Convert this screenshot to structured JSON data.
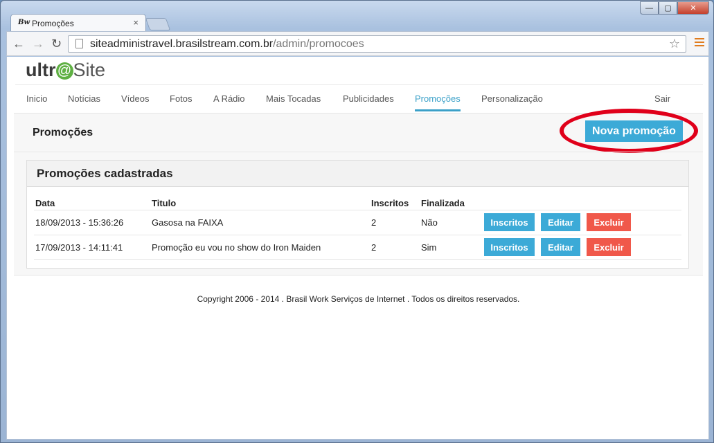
{
  "browser": {
    "tab_favicon": "Bw",
    "tab_title": "Promoções",
    "tab_close": "×",
    "url_domain": "siteadministravel.brasilstream.com.br",
    "url_path": "/admin/promocoes",
    "back": "←",
    "forward": "→",
    "reload": "↻",
    "star": "☆",
    "win_min": "—",
    "win_max": "▢",
    "win_close": "✕"
  },
  "logo": {
    "prefix": "ultr",
    "at": "@",
    "suffix": "Site"
  },
  "nav": {
    "items": [
      "Inicio",
      "Notícias",
      "Vídeos",
      "Fotos",
      "A Rádio",
      "Mais Tocadas",
      "Publicidades",
      "Promoções",
      "Personalização"
    ],
    "active": "Promoções",
    "logout": "Sair"
  },
  "page": {
    "title": "Promoções",
    "new_button": "Nova promoção"
  },
  "panel": {
    "title": "Promoções cadastradas",
    "headers": [
      "Data",
      "Titulo",
      "Inscritos",
      "Finalizada"
    ],
    "rows": [
      {
        "date": "18/09/2013 - 15:36:26",
        "title": "Gasosa na FAIXA",
        "inscritos": "2",
        "finalizada": "Não"
      },
      {
        "date": "17/09/2013 - 14:11:41",
        "title": "Promoção eu vou no show do Iron Maiden",
        "inscritos": "2",
        "finalizada": "Sim"
      }
    ],
    "actions": {
      "inscritos": "Inscritos",
      "editar": "Editar",
      "excluir": "Excluir"
    }
  },
  "footer": "Copyright 2006 - 2014 . Brasil Work Serviços de Internet . Todos os direitos reservados.",
  "colors": {
    "accent": "#3caad7",
    "danger": "#f0584a",
    "highlight": "#e0001a",
    "logo_at": "#5fb043"
  }
}
